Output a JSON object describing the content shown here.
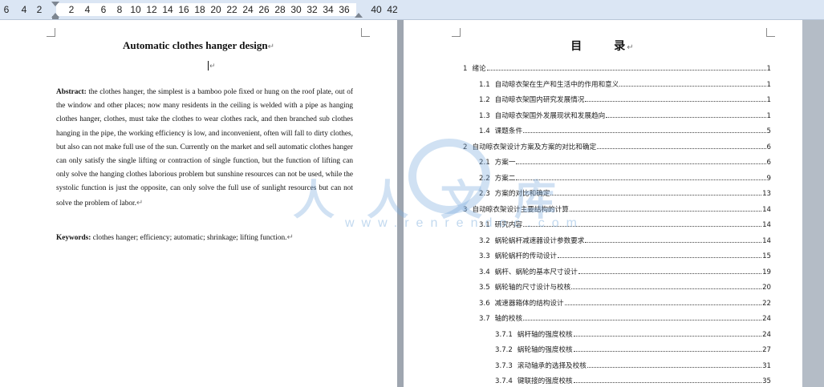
{
  "ruler": {
    "numbers": [
      "6",
      "4",
      "2",
      "2",
      "4",
      "6",
      "8",
      "10",
      "12",
      "14",
      "16",
      "18",
      "20",
      "22",
      "24",
      "26",
      "28",
      "30",
      "32",
      "34",
      "36",
      "40",
      "42"
    ]
  },
  "left_page": {
    "title": "Automatic clothes hanger design",
    "paragraph_mark": "↵",
    "abstract_label": "Abstract:",
    "abstract_text": " the clothes hanger, the simplest is a bamboo pole fixed or hung on the roof plate, out of the window and other places; now many residents in the ceiling is welded with a pipe as hanging clothes hanger, clothes, must take the clothes to wear clothes rack, and then branched sub clothes hanging in the pipe, the working efficiency is low, and inconvenient, often will fall to dirty clothes, but also can not make full use of the sun. Currently on the market and sell automatic clothes hanger can only satisfy the single lifting or contraction of single function, but the function of lifting can only solve the hanging clothes laborious problem but sunshine resources can not be used, while the systolic function is just the opposite, can only solve the full use of sunlight resources but can not solve the problem of labor.",
    "keywords_label": "Keywords:",
    "keywords_text": " clothes hanger; efficiency; automatic; shrinkage; lifting function."
  },
  "right_page": {
    "toc_title_1": "目",
    "toc_title_2": "录",
    "toc": [
      {
        "num": "1",
        "text": "绪论",
        "page": "1",
        "indent": 0
      },
      {
        "num": "1.1",
        "text": "自动晾衣架在生产和生活中的作用和意义",
        "page": "1",
        "indent": 1
      },
      {
        "num": "1.2",
        "text": "自动晾衣架国内研究发展情况",
        "page": "1",
        "indent": 1
      },
      {
        "num": "1.3",
        "text": "自动晾衣架国外发展现状和发展趋向",
        "page": "1",
        "indent": 1
      },
      {
        "num": "1.4",
        "text": "课题条件",
        "page": "5",
        "indent": 1
      },
      {
        "num": "2",
        "text": "自动晾衣架设计方案及方案的对比和确定",
        "page": "6",
        "indent": 0
      },
      {
        "num": "2.1",
        "text": "方案一",
        "page": "6",
        "indent": 1
      },
      {
        "num": "2.2",
        "text": "方案二",
        "page": "9",
        "indent": 1
      },
      {
        "num": "2.3",
        "text": "方案的对比和确定",
        "page": "13",
        "indent": 1
      },
      {
        "num": "3",
        "text": "自动晾衣架设计主要结构的计算",
        "page": "14",
        "indent": 0
      },
      {
        "num": "3.1",
        "text": "研究内容",
        "page": "14",
        "indent": 1
      },
      {
        "num": "3.2",
        "text": "蜗轮蜗杆减速器设计参数要求",
        "page": "14",
        "indent": 1
      },
      {
        "num": "3.3",
        "text": "蜗轮蜗杆的传动设计",
        "page": "15",
        "indent": 1
      },
      {
        "num": "3.4",
        "text": "蜗杆、蜗轮的基本尺寸设计",
        "page": "19",
        "indent": 1
      },
      {
        "num": "3.5",
        "text": "蜗轮轴的尺寸设计与校核",
        "page": "20",
        "indent": 1
      },
      {
        "num": "3.6",
        "text": "减速器箱体的结构设计",
        "page": "22",
        "indent": 1
      },
      {
        "num": "3.7",
        "text": "轴的校核",
        "page": "24",
        "indent": 1
      },
      {
        "num": "3.7.1",
        "text": "蜗杆轴的强度校核",
        "page": "24",
        "indent": 2
      },
      {
        "num": "3.7.2",
        "text": "蜗轮轴的强度校核",
        "page": "27",
        "indent": 2
      },
      {
        "num": "3.7.3",
        "text": "滚动轴承的选择及校核",
        "page": "31",
        "indent": 2
      },
      {
        "num": "3.7.4",
        "text": "键联接的强度校核",
        "page": "35",
        "indent": 2
      }
    ]
  },
  "watermark": {
    "chars": "人人文库",
    "url": "www.renrendoc.com"
  },
  "colors": {
    "ruler_bg": "#dbe6f4",
    "canvas_bg": "#9fa6b0",
    "page_bg": "#ffffff",
    "watermark": "#78aadc"
  }
}
